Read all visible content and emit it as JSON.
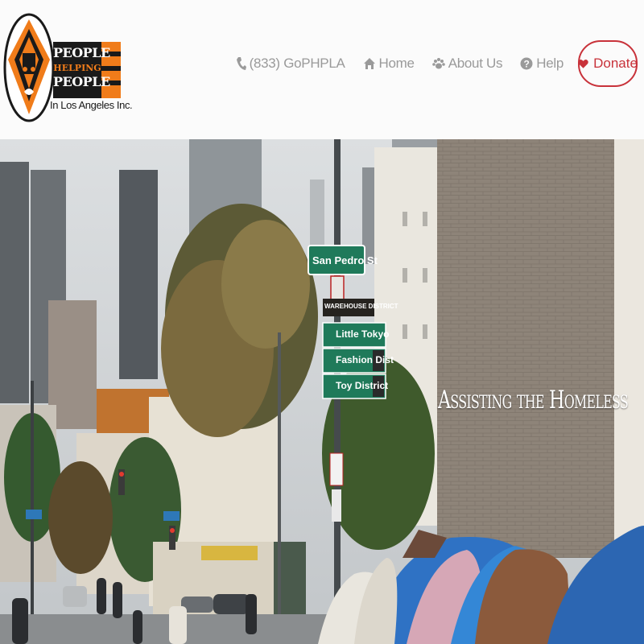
{
  "brand": {
    "line1": "PEOPLE",
    "line2": "HELPING",
    "line3": "PEOPLE",
    "line4": "In Los Angeles Inc.",
    "color_orange": "#f07c1a",
    "color_dark": "#1a1a1a"
  },
  "nav": {
    "phone_label": "(833) GoPHPLA",
    "home_label": "Home",
    "about_label": "About Us",
    "help_label": "Help",
    "donate_label": "Donate",
    "phone_icon": "phone-icon",
    "home_icon": "home-icon",
    "about_icon": "paw-icon",
    "help_icon": "question-circle-icon",
    "donate_icon": "heart-icon",
    "text_color": "#9a9a9a",
    "donate_color": "#c8323a"
  },
  "hero": {
    "title": "Assisting the Homeless",
    "signs": {
      "street": "San Pedro St",
      "district": "WAREHOUSE DISTRICT",
      "little_tokyo": "Little Tokyo",
      "fashion": "Fashion Dist",
      "toy": "Toy District"
    }
  }
}
